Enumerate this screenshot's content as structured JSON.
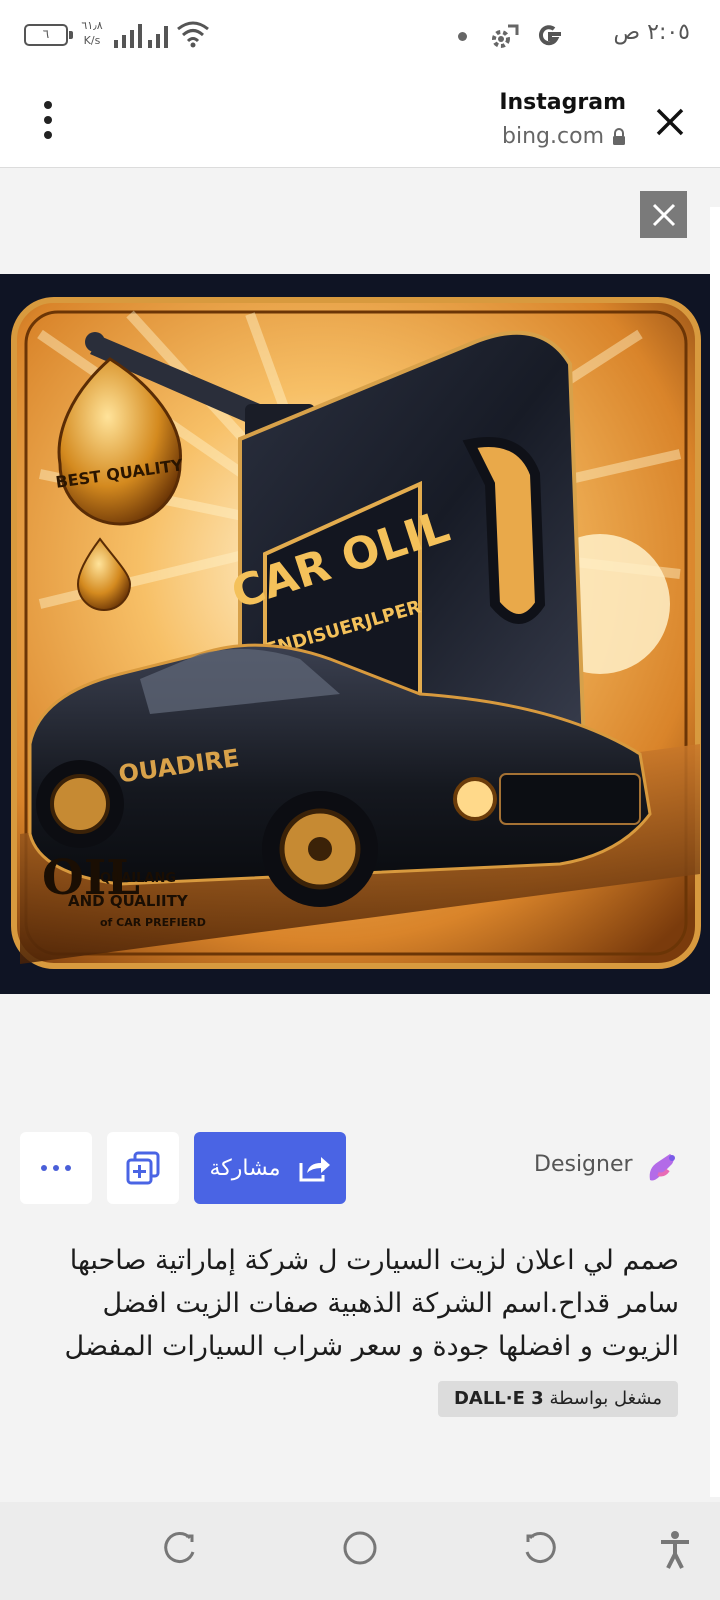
{
  "status_bar": {
    "battery_level": "٦",
    "net_speed_value": "٦١٫٨",
    "net_speed_unit": "K/s",
    "time": "٢:٠٥ ص"
  },
  "toolbar": {
    "title": "Instagram",
    "domain": "bing.com"
  },
  "actions": {
    "share_label": "مشاركة",
    "designer_label": "Designer"
  },
  "prompt": {
    "text": "صمم لي اعلان لزيت السيارت ل شركة إماراتية صاحبها سامر قداح.اسم الشركة الذهبية صفات الزيت افضل الزيوت و افضلها جودة و سعر شراب السيارات المفضل"
  },
  "badge": {
    "prefix": "مشغل بواسطة",
    "model": "DALL·E 3"
  },
  "image": {
    "can_label": "CAR OLIL",
    "can_sublabel": "ENDISUERJLPER",
    "drop_label": "BEST QUALITY",
    "car_label": "OUADIRE",
    "corner_big": "OIL",
    "corner_line1": "QUAILANG",
    "corner_line2": "AND QUALIITY",
    "corner_line3": "of CAR PREFIERD"
  },
  "colors": {
    "accent": "#4a64e4",
    "background": "#f3f3f3"
  }
}
